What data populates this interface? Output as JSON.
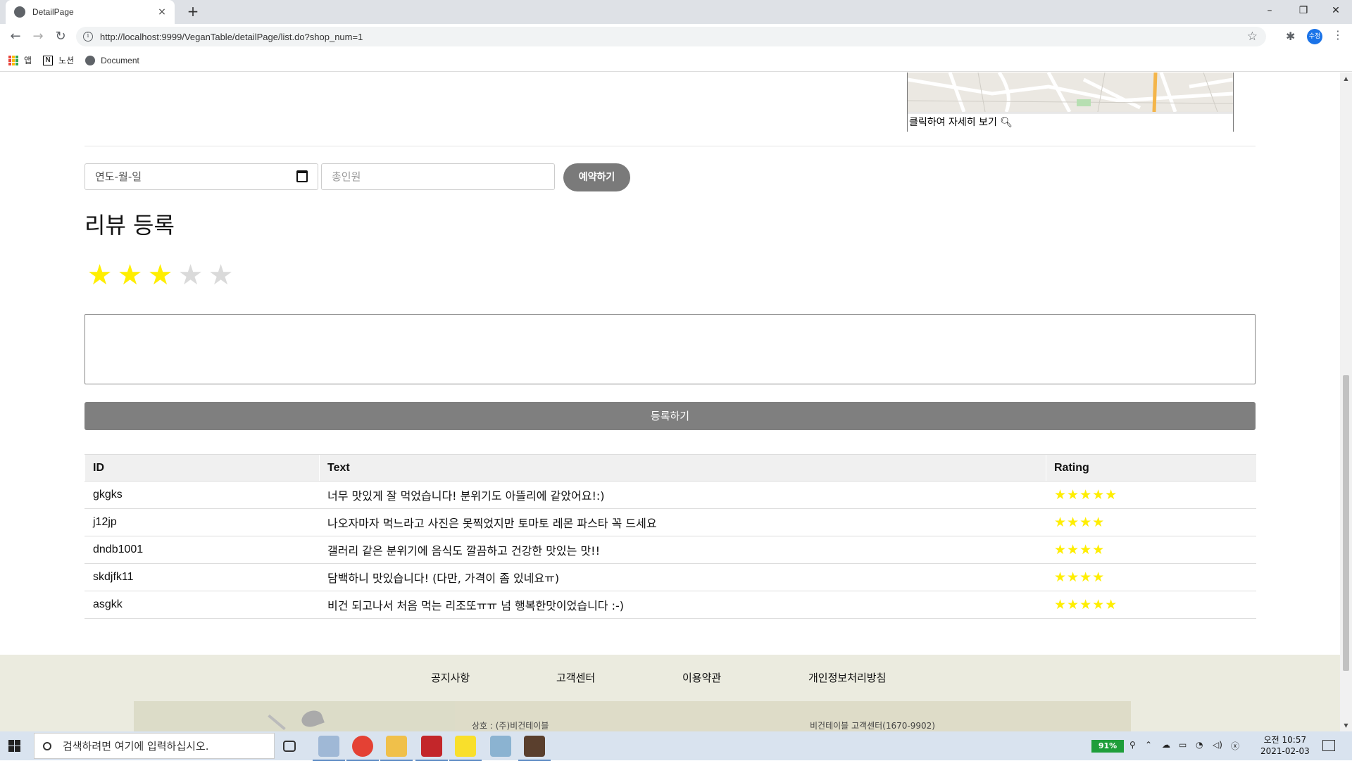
{
  "browser": {
    "tab_title": "DetailPage",
    "tab_close": "×",
    "new_tab": "+",
    "window_controls": [
      "–",
      "❐",
      "✕"
    ],
    "url": "http://localhost:9999/VeganTable/detailPage/list.do?shop_num=1",
    "profile_label": "수정",
    "bookmarks": [
      "앱",
      "노션",
      "Document"
    ]
  },
  "map": {
    "caption": "클릭하여 자세히 보기"
  },
  "reservation": {
    "date_placeholder": "연도-월-일",
    "people_placeholder": "총인원",
    "reserve_button": "예약하기"
  },
  "review_form": {
    "title": "리뷰 등록",
    "rating": 3,
    "max_rating": 5,
    "text_value": "",
    "submit_button": "등록하기"
  },
  "reviews_table": {
    "headers": [
      "ID",
      "Text",
      "Rating"
    ],
    "rows": [
      {
        "id": "gkgks",
        "text": "너무 맛있게 잘 먹었습니다! 분위기도 아뜰리에 같았어요!:)",
        "rating": 5
      },
      {
        "id": "j12jp",
        "text": "나오자마자 먹느라고 사진은 못찍었지만 토마토 레몬 파스타 꼭 드세요",
        "rating": 4
      },
      {
        "id": "dndb1001",
        "text": "갤러리 같은 분위기에 음식도 깔끔하고 건강한 맛있는 맛!!",
        "rating": 4
      },
      {
        "id": "skdjfk11",
        "text": "담백하니 맛있습니다! (다만, 가격이 좀 있네요ㅠ)",
        "rating": 4
      },
      {
        "id": "asgkk",
        "text": "비건 되고나서 처음 먹는 리조또ㅠㅠ 넘 행복한맛이었습니다 :-)",
        "rating": 5
      }
    ],
    "star_color": "#ffee00"
  },
  "footer": {
    "links": [
      "공지사항",
      "고객센터",
      "이용약관",
      "개인정보처리방침"
    ],
    "company_info": "상호 : (주)비건테이블",
    "support_info": "비건테이블 고객센터(1670-9902)"
  },
  "taskbar": {
    "search_placeholder": "검색하려면 여기에 입력하십시오.",
    "battery": "91%",
    "time": "오전 10:57",
    "date": "2021-02-03"
  }
}
